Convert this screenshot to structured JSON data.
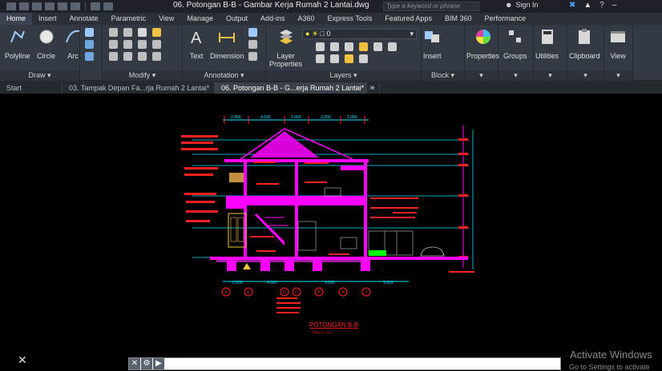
{
  "window": {
    "title": "06. Potongan B-B - Gambar Kerja Rumah 2 Lantai.dwg",
    "search_placeholder": "Type a keyword or phrase",
    "sign_in": "Sign In"
  },
  "ribbon_tabs": [
    "Home",
    "Insert",
    "Annotate",
    "Parametric",
    "View",
    "Manage",
    "Output",
    "Add-ins",
    "A360",
    "Express Tools",
    "Featured Apps",
    "BIM 360",
    "Performance"
  ],
  "ribbon": {
    "draw": {
      "title": "Draw",
      "polyline": "Polyline",
      "circle": "Circle",
      "arc": "Arc"
    },
    "modify": {
      "title": "Modify"
    },
    "annotation": {
      "title": "Annotation",
      "text": "Text",
      "dimension": "Dimension"
    },
    "layers": {
      "title": "Layers",
      "layer_properties_1": "Layer",
      "layer_properties_2": "Properties",
      "current_layer": "0"
    },
    "block": {
      "title": "Block",
      "insert": "Insert"
    },
    "properties": "Properties",
    "groups": "Groups",
    "utilities": "Utilities",
    "clipboard": "Clipboard",
    "view": "View"
  },
  "doc_tabs": [
    {
      "label": "Start"
    },
    {
      "label": "03. Tampak Depan  Fa...rja Rumah 2 Lantai*"
    },
    {
      "label": "06. Potongan B-B - G...erja Rumah 2 Lantai*"
    }
  ],
  "drawing": {
    "title": "POTONGAN B-B",
    "scale": "SKALA 1:100",
    "dims_top": [
      "2.000",
      "4.000",
      "2.000",
      "2.000",
      "2.000"
    ],
    "dims_bottom": [
      "2.000",
      "4.000",
      "3.000",
      "3.023"
    ],
    "grid_labels": [
      "F",
      "E",
      "D",
      "C",
      "B",
      "A",
      "1"
    ]
  },
  "command": {
    "placeholder": ""
  },
  "watermark": {
    "line1": "Activate Windows",
    "line2": "Go to Settings to activate"
  },
  "colors": {
    "magenta": "#ff00ff",
    "red": "#ff2020",
    "cyan": "#00e5ff",
    "green": "#00ff00",
    "bg": "#000000"
  }
}
